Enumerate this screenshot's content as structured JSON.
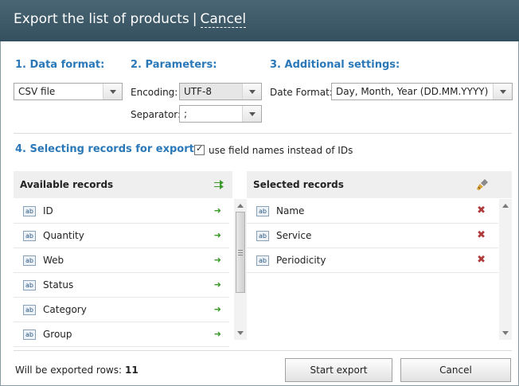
{
  "title": {
    "main": "Export the list of products",
    "separator": "|",
    "cancel": "Cancel"
  },
  "sections": {
    "data_format": "1. Data format:",
    "parameters": "2. Parameters:",
    "additional": "3. Additional settings:",
    "selecting": "4. Selecting records for export:"
  },
  "data_format": {
    "value": "CSV file"
  },
  "parameters": {
    "encoding_label": "Encoding:",
    "encoding_value": "UTF-8",
    "separator_label": "Separator:",
    "separator_value": ";"
  },
  "additional": {
    "date_label": "Date Format:",
    "date_value": "Day, Month, Year (DD.MM.YYYY)"
  },
  "use_field_names": {
    "checked": true,
    "label": "use field names instead of IDs"
  },
  "available": {
    "header": "Available records",
    "items": [
      "ID",
      "Quantity",
      "Web",
      "Status",
      "Category",
      "Group"
    ],
    "type_label": "ab"
  },
  "selected": {
    "header": "Selected records",
    "items": [
      "Name",
      "Service",
      "Periodicity"
    ],
    "type_label": "ab"
  },
  "footer": {
    "rows_label": "Will be exported rows:",
    "rows_value": "11",
    "start_button": "Start export",
    "cancel_button": "Cancel"
  },
  "icons": {
    "add_all": "double-arrow-right-icon",
    "add_one": "arrow-right-icon",
    "remove": "close-x-icon",
    "clear": "brush-icon"
  },
  "colors": {
    "titlebar": "#3d5a69",
    "section": "#2a78b8",
    "add": "#3a9a2a",
    "remove": "#b03a3a"
  }
}
